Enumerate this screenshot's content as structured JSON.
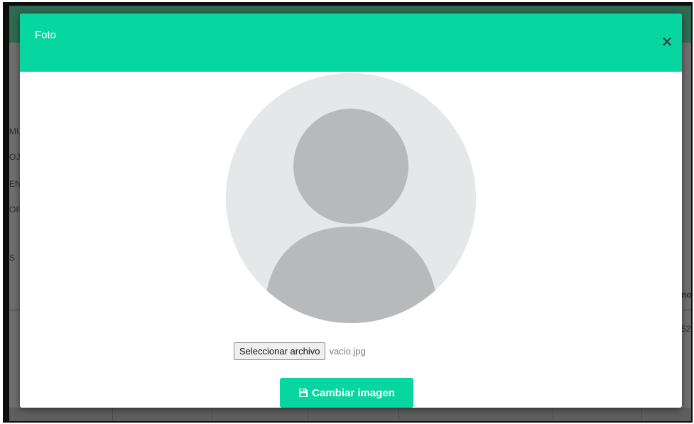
{
  "background": {
    "fragments": [
      "MU",
      "OJ",
      "EN",
      "OR",
      "S",
      "no",
      "52"
    ]
  },
  "modal": {
    "title": "Foto",
    "close_label": "×",
    "avatar": {
      "icon": "user-silhouette-icon"
    },
    "file_input": {
      "button_label": "Seleccionar archivo",
      "file_name": "vacio.jpg"
    },
    "submit": {
      "icon": "save-icon",
      "label": "Cambiar imagen"
    }
  },
  "colors": {
    "accent": "#08d6a0",
    "avatar_bg": "#e6e7e9",
    "avatar_fg": "#b8b9bb"
  }
}
